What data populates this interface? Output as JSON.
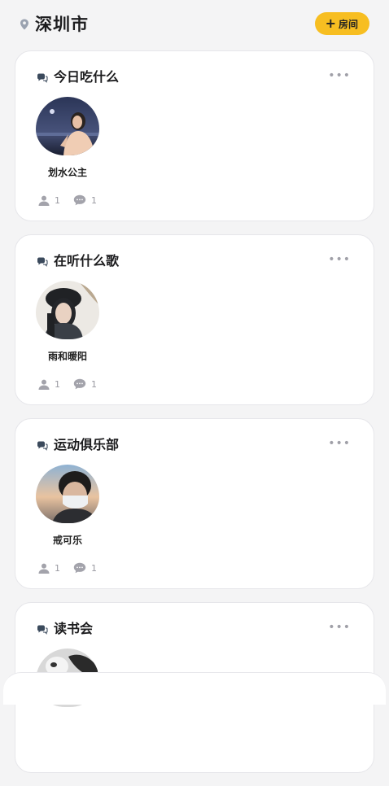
{
  "header": {
    "city": "深圳市",
    "add_room_label": "房间"
  },
  "colors": {
    "accent": "#f7be21",
    "muted": "#9a9aa2"
  },
  "rooms": [
    {
      "title": "今日吃什么",
      "member_name": "划水公主",
      "members_count": "1",
      "comments_count": "1"
    },
    {
      "title": "在听什么歌",
      "member_name": "雨和暖阳",
      "members_count": "1",
      "comments_count": "1"
    },
    {
      "title": "运动俱乐部",
      "member_name": "戒可乐",
      "members_count": "1",
      "comments_count": "1"
    },
    {
      "title": "读书会"
    }
  ],
  "icons": {
    "location": "location-pin-icon",
    "add": "plus-icon",
    "room": "chat-bubble-icon",
    "more": "more-dots-icon",
    "members": "person-icon",
    "comments": "comment-icon"
  }
}
